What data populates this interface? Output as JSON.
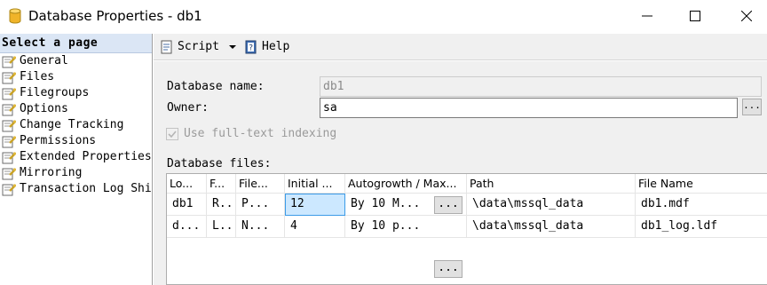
{
  "window": {
    "title": "Database Properties - db1",
    "icon": "database-icon",
    "controls": {
      "minimize": "minimize-icon",
      "maximize": "maximize-icon",
      "close": "close-icon"
    }
  },
  "sidebar": {
    "header": "Select a page",
    "items": [
      {
        "label": "General"
      },
      {
        "label": "Files"
      },
      {
        "label": "Filegroups"
      },
      {
        "label": "Options"
      },
      {
        "label": "Change Tracking"
      },
      {
        "label": "Permissions"
      },
      {
        "label": "Extended Properties"
      },
      {
        "label": "Mirroring"
      },
      {
        "label": "Transaction Log Shi"
      }
    ]
  },
  "toolbar": {
    "script_label": "Script",
    "help_label": "Help"
  },
  "form": {
    "db_name_label": "Database name:",
    "db_name_value": "db1",
    "owner_label": "Owner:",
    "owner_value": "sa",
    "owner_browse": "...",
    "fulltext_label": "Use full-text indexing",
    "db_files_label": "Database files:"
  },
  "grid": {
    "columns": [
      "Lo...",
      "F...",
      "File...",
      "Initial ...",
      "Autogrowth / Max...",
      "Path",
      "File Name"
    ],
    "rows": [
      {
        "logical": "db1",
        "file_type": "R...",
        "filegroup": "P...",
        "initial": "12",
        "autogrowth": "By 10 M...",
        "button": "...",
        "path": "\\data\\mssql_data",
        "file_name": "db1.mdf"
      },
      {
        "logical": "d...",
        "file_type": "L...",
        "filegroup": "N...",
        "initial": "4",
        "autogrowth": "By 10 p...",
        "button": "...",
        "path": "\\data\\mssql_data",
        "file_name": "db1_log.ldf"
      }
    ]
  },
  "colors": {
    "sidebar_header_bg": "#dbe6f5",
    "panel_bg": "#f0f0f0",
    "selected_cell_bg": "#cce8ff",
    "selected_cell_border": "#3c9be8"
  }
}
